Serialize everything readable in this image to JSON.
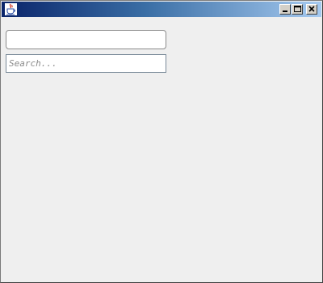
{
  "window": {
    "title": "",
    "colors": {
      "titlebar_start": "#0a246a",
      "titlebar_end": "#a6caf0",
      "background": "#efefef"
    },
    "icons": {
      "app": "java-cup-icon",
      "minimize": "minimize-icon",
      "maximize": "maximize-icon",
      "close": "close-icon"
    }
  },
  "form": {
    "top_field_value": "",
    "search_field_value": "",
    "search_placeholder": "Search..."
  }
}
